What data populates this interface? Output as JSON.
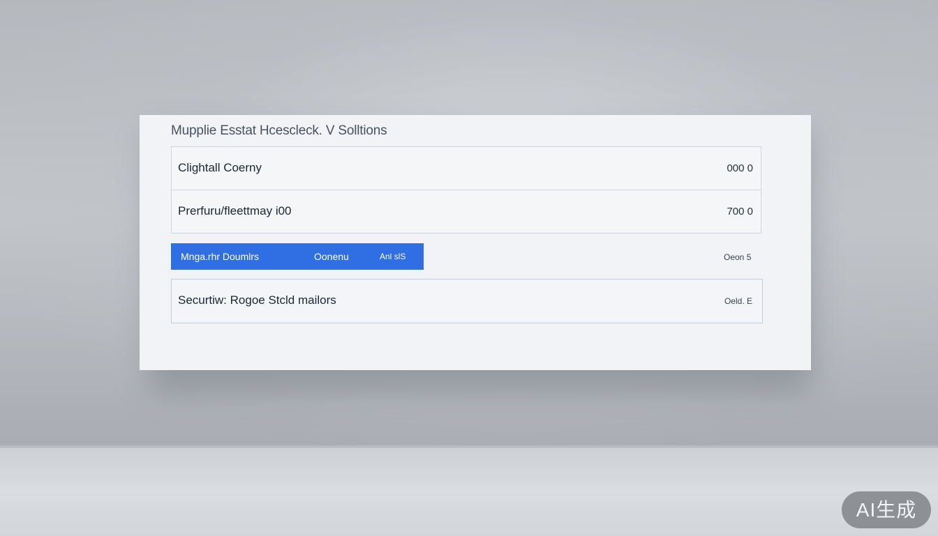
{
  "panel": {
    "title": "Mupplie Esstat Hcescleck. V Solltions",
    "rows": [
      {
        "label": "Clightall Coerny",
        "value": "000 0"
      },
      {
        "label": "Prerfuru/fleettmay i00",
        "value": "700 0"
      }
    ],
    "highlight": {
      "col1": "Mnga.rhr Doumlrs",
      "col2": "Oonenu",
      "col3": "Anl slS",
      "outside_value": "Oeon 5"
    },
    "security": {
      "label": "Securtiw: Rogoe Stcld mailors",
      "value": "Oeld. E"
    }
  },
  "badge": {
    "label": "AI生成"
  },
  "colors": {
    "accent": "#2f6fe3",
    "panel_bg": "#f1f3f6",
    "background": "#b9bdc2"
  }
}
